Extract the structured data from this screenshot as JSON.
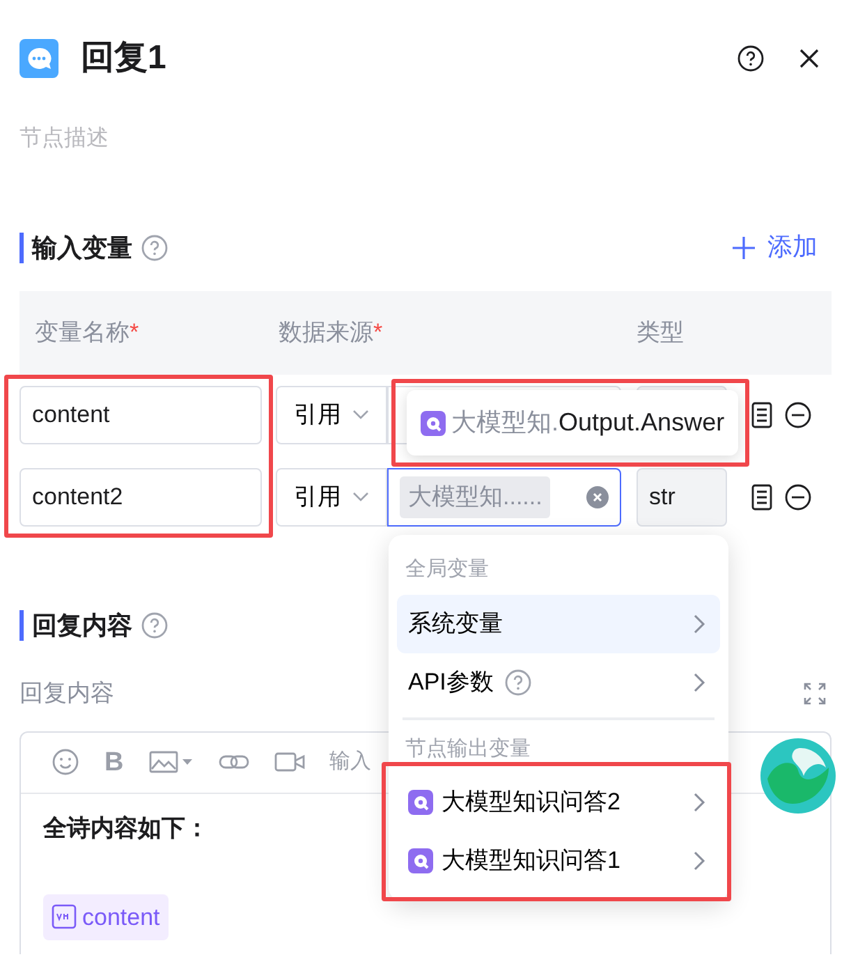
{
  "panel": {
    "title": "回复1",
    "description_placeholder": "节点描述"
  },
  "input_section": {
    "title": "输入变量",
    "add_label": "添加"
  },
  "columns": [
    {
      "label": "变量名称",
      "required_mark": "*"
    },
    {
      "label": "数据来源",
      "required_mark": "*"
    },
    {
      "label": "类型"
    }
  ],
  "highlight_name_inputs": true,
  "rows": [
    {
      "name": "content",
      "source": "引用",
      "focused": false
    },
    {
      "name": "content2",
      "source": "引用",
      "focused": true,
      "value_tag": "大模型知......",
      "type": "str"
    }
  ],
  "tooltip": {
    "prefix": "大模型知.",
    "text": "Output.Answer",
    "highlighted": true
  },
  "menu": {
    "groups": [
      {
        "label": "全局变量",
        "items": [
          {
            "label": "系统变量",
            "selected": true,
            "kind": "plain"
          },
          {
            "label": "API参数",
            "selected": false,
            "kind": "help"
          }
        ]
      },
      {
        "label": "节点输出变量",
        "highlighted": true,
        "items": [
          {
            "label": "大模型知识问答2",
            "selected": false,
            "kind": "node"
          },
          {
            "label": "大模型知识问答1",
            "selected": false,
            "kind": "node"
          }
        ]
      }
    ]
  },
  "reply_section": {
    "title": "回复内容",
    "field_label": "回复内容",
    "bold_label": "B",
    "toolbar_hint": "输入",
    "content_heading": "全诗内容如下：",
    "variable_tag": "content"
  }
}
